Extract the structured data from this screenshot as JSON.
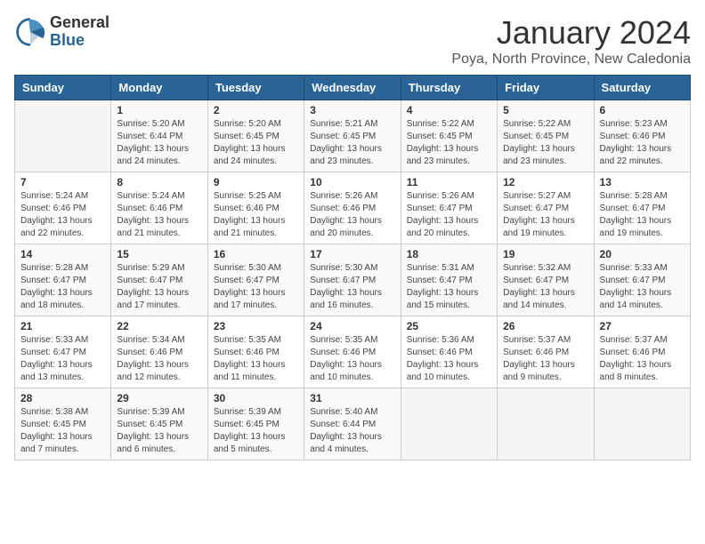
{
  "logo": {
    "general": "General",
    "blue": "Blue"
  },
  "title": "January 2024",
  "location": "Poya, North Province, New Caledonia",
  "days_of_week": [
    "Sunday",
    "Monday",
    "Tuesday",
    "Wednesday",
    "Thursday",
    "Friday",
    "Saturday"
  ],
  "weeks": [
    [
      {
        "day": "",
        "sunrise": "",
        "sunset": "",
        "daylight": ""
      },
      {
        "day": "1",
        "sunrise": "Sunrise: 5:20 AM",
        "sunset": "Sunset: 6:44 PM",
        "daylight": "Daylight: 13 hours and 24 minutes."
      },
      {
        "day": "2",
        "sunrise": "Sunrise: 5:20 AM",
        "sunset": "Sunset: 6:45 PM",
        "daylight": "Daylight: 13 hours and 24 minutes."
      },
      {
        "day": "3",
        "sunrise": "Sunrise: 5:21 AM",
        "sunset": "Sunset: 6:45 PM",
        "daylight": "Daylight: 13 hours and 23 minutes."
      },
      {
        "day": "4",
        "sunrise": "Sunrise: 5:22 AM",
        "sunset": "Sunset: 6:45 PM",
        "daylight": "Daylight: 13 hours and 23 minutes."
      },
      {
        "day": "5",
        "sunrise": "Sunrise: 5:22 AM",
        "sunset": "Sunset: 6:45 PM",
        "daylight": "Daylight: 13 hours and 23 minutes."
      },
      {
        "day": "6",
        "sunrise": "Sunrise: 5:23 AM",
        "sunset": "Sunset: 6:46 PM",
        "daylight": "Daylight: 13 hours and 22 minutes."
      }
    ],
    [
      {
        "day": "7",
        "sunrise": "Sunrise: 5:24 AM",
        "sunset": "Sunset: 6:46 PM",
        "daylight": "Daylight: 13 hours and 22 minutes."
      },
      {
        "day": "8",
        "sunrise": "Sunrise: 5:24 AM",
        "sunset": "Sunset: 6:46 PM",
        "daylight": "Daylight: 13 hours and 21 minutes."
      },
      {
        "day": "9",
        "sunrise": "Sunrise: 5:25 AM",
        "sunset": "Sunset: 6:46 PM",
        "daylight": "Daylight: 13 hours and 21 minutes."
      },
      {
        "day": "10",
        "sunrise": "Sunrise: 5:26 AM",
        "sunset": "Sunset: 6:46 PM",
        "daylight": "Daylight: 13 hours and 20 minutes."
      },
      {
        "day": "11",
        "sunrise": "Sunrise: 5:26 AM",
        "sunset": "Sunset: 6:47 PM",
        "daylight": "Daylight: 13 hours and 20 minutes."
      },
      {
        "day": "12",
        "sunrise": "Sunrise: 5:27 AM",
        "sunset": "Sunset: 6:47 PM",
        "daylight": "Daylight: 13 hours and 19 minutes."
      },
      {
        "day": "13",
        "sunrise": "Sunrise: 5:28 AM",
        "sunset": "Sunset: 6:47 PM",
        "daylight": "Daylight: 13 hours and 19 minutes."
      }
    ],
    [
      {
        "day": "14",
        "sunrise": "Sunrise: 5:28 AM",
        "sunset": "Sunset: 6:47 PM",
        "daylight": "Daylight: 13 hours and 18 minutes."
      },
      {
        "day": "15",
        "sunrise": "Sunrise: 5:29 AM",
        "sunset": "Sunset: 6:47 PM",
        "daylight": "Daylight: 13 hours and 17 minutes."
      },
      {
        "day": "16",
        "sunrise": "Sunrise: 5:30 AM",
        "sunset": "Sunset: 6:47 PM",
        "daylight": "Daylight: 13 hours and 17 minutes."
      },
      {
        "day": "17",
        "sunrise": "Sunrise: 5:30 AM",
        "sunset": "Sunset: 6:47 PM",
        "daylight": "Daylight: 13 hours and 16 minutes."
      },
      {
        "day": "18",
        "sunrise": "Sunrise: 5:31 AM",
        "sunset": "Sunset: 6:47 PM",
        "daylight": "Daylight: 13 hours and 15 minutes."
      },
      {
        "day": "19",
        "sunrise": "Sunrise: 5:32 AM",
        "sunset": "Sunset: 6:47 PM",
        "daylight": "Daylight: 13 hours and 14 minutes."
      },
      {
        "day": "20",
        "sunrise": "Sunrise: 5:33 AM",
        "sunset": "Sunset: 6:47 PM",
        "daylight": "Daylight: 13 hours and 14 minutes."
      }
    ],
    [
      {
        "day": "21",
        "sunrise": "Sunrise: 5:33 AM",
        "sunset": "Sunset: 6:47 PM",
        "daylight": "Daylight: 13 hours and 13 minutes."
      },
      {
        "day": "22",
        "sunrise": "Sunrise: 5:34 AM",
        "sunset": "Sunset: 6:46 PM",
        "daylight": "Daylight: 13 hours and 12 minutes."
      },
      {
        "day": "23",
        "sunrise": "Sunrise: 5:35 AM",
        "sunset": "Sunset: 6:46 PM",
        "daylight": "Daylight: 13 hours and 11 minutes."
      },
      {
        "day": "24",
        "sunrise": "Sunrise: 5:35 AM",
        "sunset": "Sunset: 6:46 PM",
        "daylight": "Daylight: 13 hours and 10 minutes."
      },
      {
        "day": "25",
        "sunrise": "Sunrise: 5:36 AM",
        "sunset": "Sunset: 6:46 PM",
        "daylight": "Daylight: 13 hours and 10 minutes."
      },
      {
        "day": "26",
        "sunrise": "Sunrise: 5:37 AM",
        "sunset": "Sunset: 6:46 PM",
        "daylight": "Daylight: 13 hours and 9 minutes."
      },
      {
        "day": "27",
        "sunrise": "Sunrise: 5:37 AM",
        "sunset": "Sunset: 6:46 PM",
        "daylight": "Daylight: 13 hours and 8 minutes."
      }
    ],
    [
      {
        "day": "28",
        "sunrise": "Sunrise: 5:38 AM",
        "sunset": "Sunset: 6:45 PM",
        "daylight": "Daylight: 13 hours and 7 minutes."
      },
      {
        "day": "29",
        "sunrise": "Sunrise: 5:39 AM",
        "sunset": "Sunset: 6:45 PM",
        "daylight": "Daylight: 13 hours and 6 minutes."
      },
      {
        "day": "30",
        "sunrise": "Sunrise: 5:39 AM",
        "sunset": "Sunset: 6:45 PM",
        "daylight": "Daylight: 13 hours and 5 minutes."
      },
      {
        "day": "31",
        "sunrise": "Sunrise: 5:40 AM",
        "sunset": "Sunset: 6:44 PM",
        "daylight": "Daylight: 13 hours and 4 minutes."
      },
      {
        "day": "",
        "sunrise": "",
        "sunset": "",
        "daylight": ""
      },
      {
        "day": "",
        "sunrise": "",
        "sunset": "",
        "daylight": ""
      },
      {
        "day": "",
        "sunrise": "",
        "sunset": "",
        "daylight": ""
      }
    ]
  ]
}
